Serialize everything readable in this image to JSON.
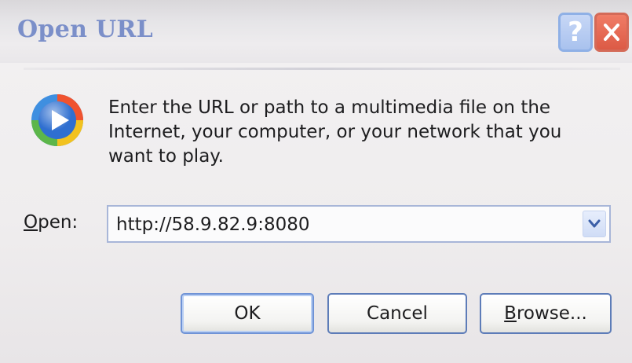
{
  "window": {
    "title": "Open URL",
    "help_label": "?",
    "close_label": "close"
  },
  "message": {
    "text": "Enter the URL or path to a multimedia file on the Internet, your computer, or your network that you want to play.",
    "icon": "windows-media-player-icon"
  },
  "open_field": {
    "label_mnemonic": "O",
    "label_rest": "pen:",
    "value": "http://58.9.82.9:8080",
    "dropdown_icon": "chevron-down-icon"
  },
  "buttons": {
    "ok": "OK",
    "cancel": "Cancel",
    "browse_mnemonic": "B",
    "browse_rest": "rowse..."
  },
  "colors": {
    "title_text": "#7b8fc9",
    "close_button": "#dc5a45",
    "help_button": "#a9c2ee",
    "button_border": "#5d7cb8"
  }
}
